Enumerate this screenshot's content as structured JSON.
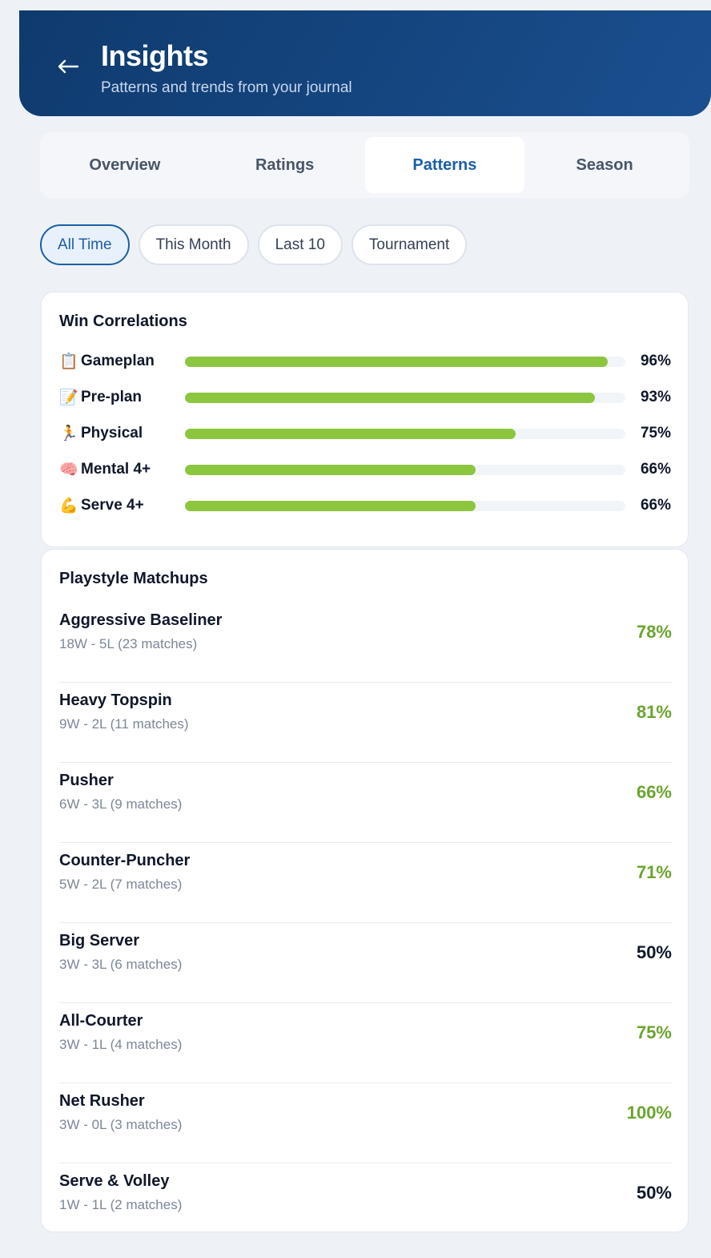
{
  "header": {
    "title": "Insights",
    "subtitle": "Patterns and trends from your journal"
  },
  "tabs": [
    {
      "label": "Overview",
      "active": false
    },
    {
      "label": "Ratings",
      "active": false
    },
    {
      "label": "Patterns",
      "active": true
    },
    {
      "label": "Season",
      "active": false
    }
  ],
  "filters": [
    {
      "label": "All Time",
      "active": true
    },
    {
      "label": "This Month",
      "active": false
    },
    {
      "label": "Last 10",
      "active": false
    },
    {
      "label": "Tournament",
      "active": false
    }
  ],
  "win_correlations": {
    "title": "Win Correlations",
    "bar_color": "#8cc63f",
    "items": [
      {
        "icon": "📋",
        "label": "Gameplan",
        "value": "96%",
        "fill": 0.96
      },
      {
        "icon": "📝",
        "label": "Pre-plan",
        "value": "93%",
        "fill": 0.93
      },
      {
        "icon": "🏃",
        "label": "Physical",
        "value": "75%",
        "fill": 0.75
      },
      {
        "icon": "🧠",
        "label": "Mental 4+",
        "value": "66%",
        "fill": 0.66
      },
      {
        "icon": "💪",
        "label": "Serve 4+",
        "value": "66%",
        "fill": 0.66
      }
    ]
  },
  "playstyle_matchups": {
    "title": "Playstyle Matchups",
    "good_color": "#6aa42e",
    "items": [
      {
        "name": "Aggressive Baseliner",
        "record": "18W - 5L (23 matches)",
        "pct": "78%",
        "positive": true
      },
      {
        "name": "Heavy Topspin",
        "record": "9W - 2L (11 matches)",
        "pct": "81%",
        "positive": true
      },
      {
        "name": "Pusher",
        "record": "6W - 3L (9 matches)",
        "pct": "66%",
        "positive": true
      },
      {
        "name": "Counter-Puncher",
        "record": "5W - 2L (7 matches)",
        "pct": "71%",
        "positive": true
      },
      {
        "name": "Big Server",
        "record": "3W - 3L (6 matches)",
        "pct": "50%",
        "positive": false
      },
      {
        "name": "All-Courter",
        "record": "3W - 1L (4 matches)",
        "pct": "75%",
        "positive": true
      },
      {
        "name": "Net Rusher",
        "record": "3W - 0L (3 matches)",
        "pct": "100%",
        "positive": true
      },
      {
        "name": "Serve & Volley",
        "record": "1W - 1L (2 matches)",
        "pct": "50%",
        "positive": false
      }
    ]
  }
}
